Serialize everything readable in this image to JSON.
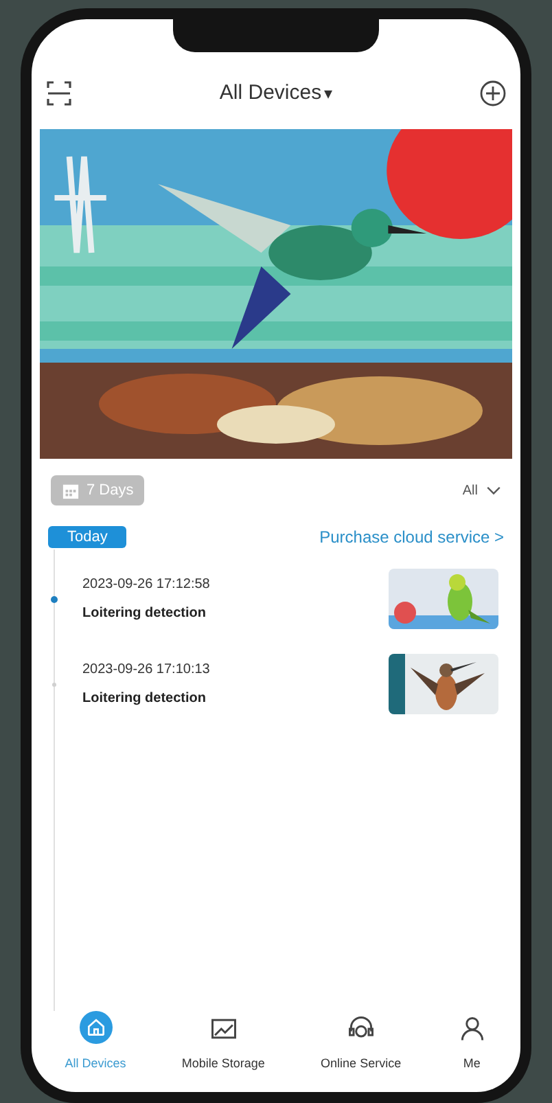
{
  "header": {
    "title": "All Devices",
    "caret": "▾"
  },
  "filter": {
    "range": "7 Days",
    "type": "All"
  },
  "timeline": {
    "day": "Today",
    "cloud_link": "Purchase cloud service >",
    "events": [
      {
        "time": "2023-09-26 17:12:58",
        "label": "Loitering detection",
        "selected": true
      },
      {
        "time": "2023-09-26 17:10:13",
        "label": "Loitering detection",
        "selected": false
      }
    ]
  },
  "tabs": [
    {
      "label": "All Devices",
      "kind": "home",
      "selected": true
    },
    {
      "label": "Mobile Storage",
      "kind": "storage",
      "selected": false
    },
    {
      "label": "Online Service",
      "kind": "service",
      "selected": false
    },
    {
      "label": "Me",
      "kind": "person",
      "selected": false
    }
  ]
}
